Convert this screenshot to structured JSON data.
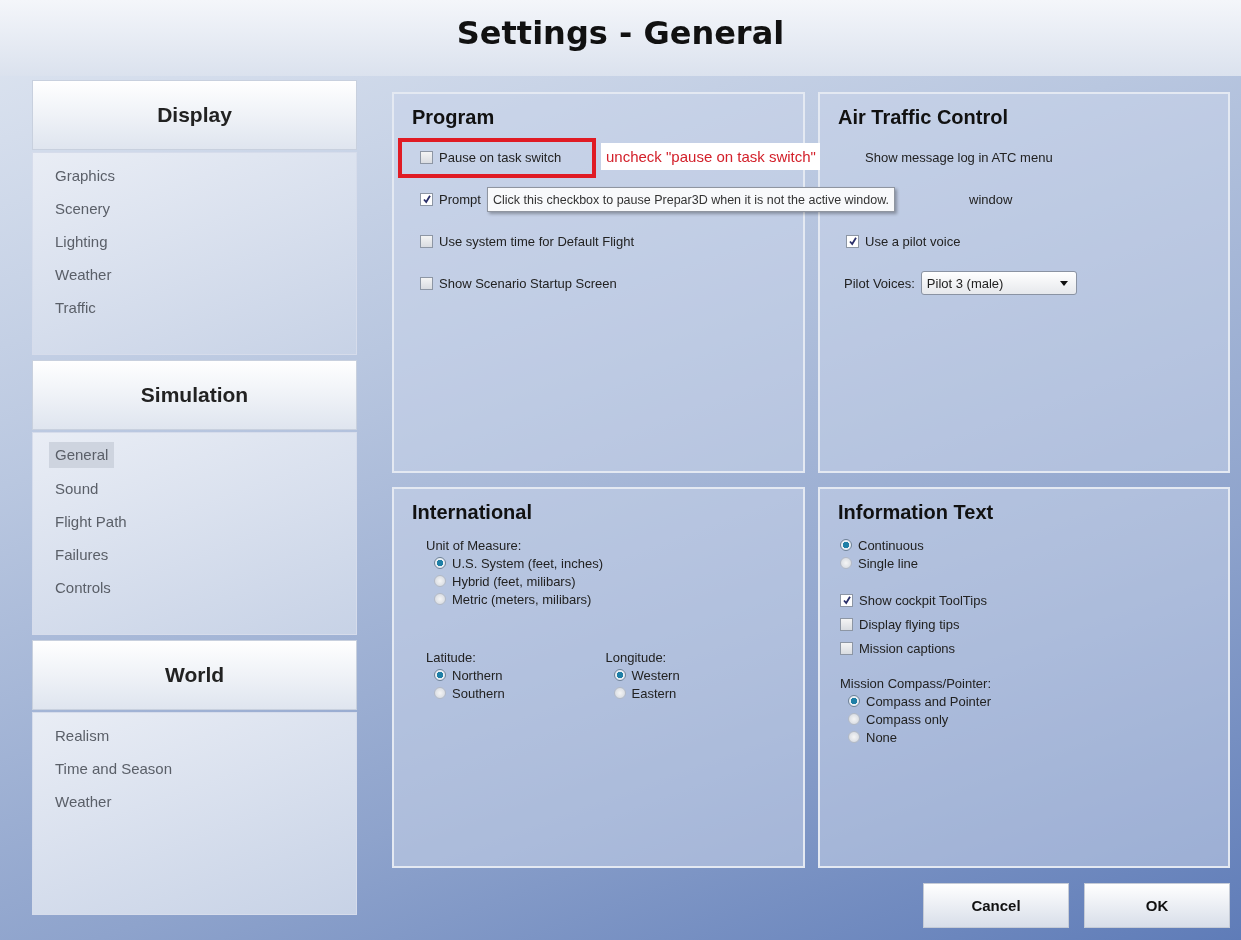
{
  "window": {
    "title": "Settings - General"
  },
  "sidebar": [
    {
      "header": "Display",
      "items": [
        {
          "label": "Graphics",
          "selected": false
        },
        {
          "label": "Scenery",
          "selected": false
        },
        {
          "label": "Lighting",
          "selected": false
        },
        {
          "label": "Weather",
          "selected": false
        },
        {
          "label": "Traffic",
          "selected": false
        }
      ]
    },
    {
      "header": "Simulation",
      "items": [
        {
          "label": "General",
          "selected": true
        },
        {
          "label": "Sound",
          "selected": false
        },
        {
          "label": "Flight Path",
          "selected": false
        },
        {
          "label": "Failures",
          "selected": false
        },
        {
          "label": "Controls",
          "selected": false
        }
      ]
    },
    {
      "header": "World",
      "items": [
        {
          "label": "Realism",
          "selected": false
        },
        {
          "label": "Time and Season",
          "selected": false
        },
        {
          "label": "Weather",
          "selected": false
        }
      ]
    }
  ],
  "panels": [
    {
      "title": "Program",
      "controls": [
        {
          "kind": "checkbox",
          "label": "Pause on task switch",
          "checked": false
        },
        {
          "kind": "checkbox",
          "label": "Prompt",
          "checked": true
        },
        {
          "kind": "checkbox",
          "label": "Use system time for Default Flight",
          "checked": false
        },
        {
          "kind": "checkbox",
          "label": "Show Scenario Startup Screen",
          "checked": false
        }
      ]
    },
    {
      "title": "Air Traffic Control",
      "controls": [
        {
          "kind": "text",
          "label": "Show message log in ATC menu"
        },
        {
          "kind": "text",
          "label": "window"
        },
        {
          "kind": "checkbox",
          "label": "Use a pilot voice",
          "checked": true
        },
        {
          "kind": "dropdown",
          "label": "Pilot Voices:",
          "value": "Pilot 3 (male)"
        }
      ]
    },
    {
      "title": "International",
      "controls": [
        {
          "kind": "label",
          "label": "Unit of Measure:"
        },
        {
          "kind": "radio",
          "label": "U.S. System (feet, inches)",
          "selected": true
        },
        {
          "kind": "radio",
          "label": "Hybrid (feet, milibars)",
          "selected": false
        },
        {
          "kind": "radio",
          "label": "Metric (meters, milibars)",
          "selected": false
        },
        {
          "kind": "columns",
          "columns": [
            [
              {
                "kind": "label",
                "label": "Latitude:"
              },
              {
                "kind": "radio",
                "label": "Northern",
                "selected": true
              },
              {
                "kind": "radio",
                "label": "Southern",
                "selected": false
              }
            ],
            [
              {
                "kind": "label",
                "label": "Longitude:"
              },
              {
                "kind": "radio",
                "label": "Western",
                "selected": true
              },
              {
                "kind": "radio",
                "label": "Eastern",
                "selected": false
              }
            ]
          ]
        }
      ]
    },
    {
      "title": "Information Text",
      "controls": [
        {
          "kind": "radio",
          "label": "Continuous",
          "selected": true
        },
        {
          "kind": "radio",
          "label": "Single line",
          "selected": false
        },
        {
          "kind": "checkbox",
          "label": "Show cockpit ToolTips",
          "checked": true
        },
        {
          "kind": "checkbox",
          "label": "Display flying tips",
          "checked": false
        },
        {
          "kind": "checkbox",
          "label": "Mission captions",
          "checked": false
        },
        {
          "kind": "label",
          "label": "Mission Compass/Pointer:"
        },
        {
          "kind": "radio",
          "label": "Compass and Pointer",
          "selected": true
        },
        {
          "kind": "radio",
          "label": "Compass only",
          "selected": false
        },
        {
          "kind": "radio",
          "label": "None",
          "selected": false
        }
      ]
    }
  ],
  "annotation": {
    "text": "uncheck \"pause on task switch\""
  },
  "tooltip": {
    "text": "Click this checkbox to pause Prepar3D when it is not the active window."
  },
  "buttons": [
    "Cancel",
    "OK"
  ]
}
